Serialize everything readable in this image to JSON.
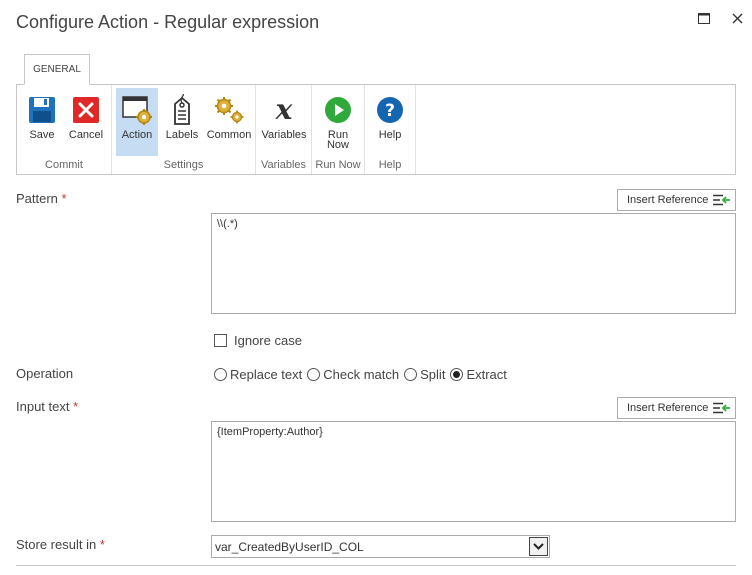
{
  "dialog": {
    "title": "Configure Action - Regular expression"
  },
  "ribbon": {
    "tab_label": "GENERAL",
    "groups": {
      "commit": "Commit",
      "settings": "Settings",
      "variables": "Variables",
      "run_now": "Run Now",
      "help": "Help"
    },
    "buttons": {
      "save": "Save",
      "cancel": "Cancel",
      "action": "Action",
      "labels": "Labels",
      "common": "Common",
      "variables": "Variables",
      "run_now": "Run Now",
      "help": "Help"
    },
    "icons": {
      "save": "floppy-disk-icon",
      "cancel": "red-x-icon",
      "action": "gear-window-icon",
      "labels": "tag-icon",
      "common": "gears-icon",
      "variables": "variable-x-icon",
      "run_now": "play-icon",
      "help": "help-question-icon"
    },
    "colors": {
      "active_bg": "#c5dcf2",
      "save_blue": "#1e73be",
      "cancel_red": "#e02828",
      "run_green": "#2faa3a",
      "help_blue": "#1565b0",
      "gear_gold": "#e0b13a"
    }
  },
  "form": {
    "required_marker": "*",
    "insert_reference_label": "Insert Reference",
    "pattern": {
      "label": "Pattern",
      "value": "\\\\(.*)"
    },
    "ignore_case": {
      "label": "Ignore case",
      "checked": false
    },
    "operation": {
      "label": "Operation",
      "options": [
        "Replace text",
        "Check match",
        "Split",
        "Extract"
      ],
      "selected": "Extract"
    },
    "input_text": {
      "label": "Input text",
      "value": "{ItemProperty:Author}"
    },
    "store_result": {
      "label": "Store result in",
      "value": "var_CreatedByUserID_COL"
    }
  }
}
